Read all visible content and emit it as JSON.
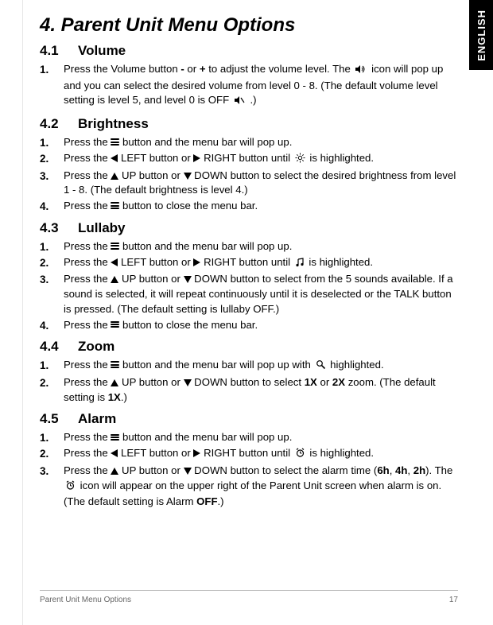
{
  "lang_tab": "ENGLISH",
  "heading": "4. Parent Unit Menu Options",
  "s41": {
    "num": "4.1",
    "title": "Volume",
    "steps": [
      {
        "t1": "Press the Volume button ",
        "minus": "-",
        "t2": " or ",
        "plus": "+",
        "t3": " to adjust the volume level. The ",
        "t4": " icon will pop up and you can select the desired volume from level 0 - 8. (The default volume level setting is level 5, and level 0 is OFF ",
        "t5": " .)"
      }
    ]
  },
  "s42": {
    "num": "4.2",
    "title": "Brightness",
    "steps": [
      {
        "t1": "Press the ",
        "t2": " button and the menu bar will pop up."
      },
      {
        "t1": "Press the ",
        "left": " LEFT button or ",
        "right": " RIGHT button until ",
        "t2": " is highlighted."
      },
      {
        "t1": "Press the ",
        "up": " UP button or ",
        "down": " DOWN button to select the desired brightness from level 1 - 8. (The default brightness is level 4.)"
      },
      {
        "t1": "Press the ",
        "t2": " button to close the menu bar."
      }
    ]
  },
  "s43": {
    "num": "4.3",
    "title": "Lullaby",
    "steps": [
      {
        "t1": "Press the ",
        "t2": " button and the menu bar will pop up."
      },
      {
        "t1": "Press the ",
        "left": " LEFT button or ",
        "right": " RIGHT button until ",
        "t2": " is highlighted."
      },
      {
        "t1": "Press the ",
        "up": " UP button or ",
        "down": " DOWN button to select from the 5 sounds available. If a sound is selected, it will repeat continuously until it is deselected or the TALK button is pressed. (The default setting is lullaby OFF.)"
      },
      {
        "t1": "Press the ",
        "t2": " button to close the menu bar."
      }
    ]
  },
  "s44": {
    "num": "4.4",
    "title": "Zoom",
    "steps": [
      {
        "t1": "Press the ",
        "t2": " button and the menu bar will pop up with ",
        "t3": " highlighted."
      },
      {
        "t1": "Press the ",
        "up": " UP button or ",
        "down": " DOWN button to select ",
        "x1": "1X",
        "or": " or ",
        "x2": "2X",
        "t2": " zoom. (The default setting is ",
        "x3": "1X",
        "t3": ".)"
      }
    ]
  },
  "s45": {
    "num": "4.5",
    "title": "Alarm",
    "steps": [
      {
        "t1": "Press the ",
        "t2": " button and the menu bar will pop up."
      },
      {
        "t1": "Press the ",
        "left": " LEFT button or ",
        "right": " RIGHT button until ",
        "t2": " is highlighted."
      },
      {
        "t1": "Press the ",
        "up": " UP button or ",
        "down": " DOWN button to select the alarm time (",
        "h6": "6h",
        "c1": ", ",
        "h4": "4h",
        "c2": ", ",
        "h2": "2h",
        "t2": "). The ",
        "t3": " icon will appear on the upper right of the Parent Unit screen when alarm is on. (The default setting is Alarm ",
        "off": "OFF",
        "t4": ".)"
      }
    ]
  },
  "footer": {
    "left": "Parent Unit Menu Options",
    "right": "17"
  }
}
